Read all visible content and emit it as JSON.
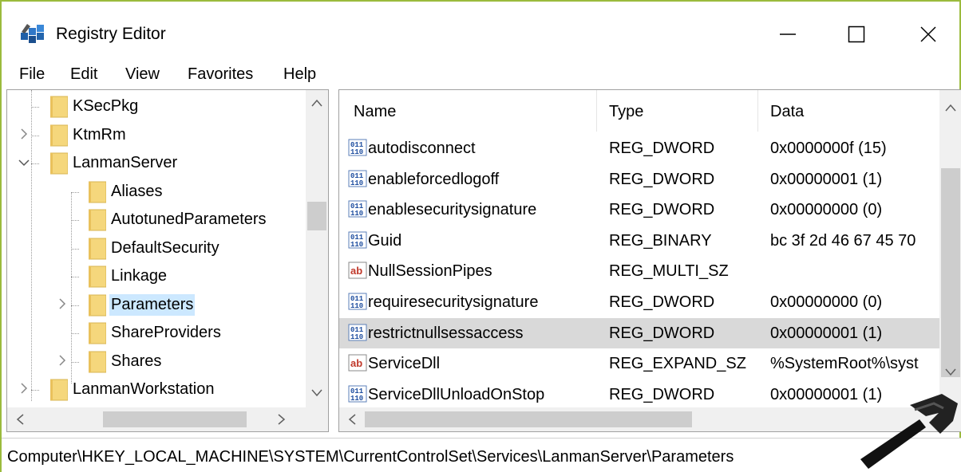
{
  "window": {
    "title": "Registry Editor"
  },
  "menu": [
    "File",
    "Edit",
    "View",
    "Favorites",
    "Help"
  ],
  "tree": [
    {
      "label": "KSecPkg",
      "level": 1,
      "expander": ""
    },
    {
      "label": "KtmRm",
      "level": 1,
      "expander": ">"
    },
    {
      "label": "LanmanServer",
      "level": 1,
      "expander": "v"
    },
    {
      "label": "Aliases",
      "level": 2,
      "expander": ""
    },
    {
      "label": "AutotunedParameters",
      "level": 2,
      "expander": ""
    },
    {
      "label": "DefaultSecurity",
      "level": 2,
      "expander": ""
    },
    {
      "label": "Linkage",
      "level": 2,
      "expander": ""
    },
    {
      "label": "Parameters",
      "level": 2,
      "expander": ">",
      "selected": true
    },
    {
      "label": "ShareProviders",
      "level": 2,
      "expander": ""
    },
    {
      "label": "Shares",
      "level": 2,
      "expander": ">"
    },
    {
      "label": "LanmanWorkstation",
      "level": 1,
      "expander": ">"
    }
  ],
  "columns": {
    "name": "Name",
    "type": "Type",
    "data": "Data"
  },
  "values": [
    {
      "name": "autodisconnect",
      "type": "REG_DWORD",
      "data": "0x0000000f (15)",
      "icon": "binary-value-icon"
    },
    {
      "name": "enableforcedlogoff",
      "type": "REG_DWORD",
      "data": "0x00000001 (1)",
      "icon": "binary-value-icon"
    },
    {
      "name": "enablesecuritysignature",
      "type": "REG_DWORD",
      "data": "0x00000000 (0)",
      "icon": "binary-value-icon"
    },
    {
      "name": "Guid",
      "type": "REG_BINARY",
      "data": "bc 3f 2d 46 67 45 70",
      "icon": "binary-value-icon"
    },
    {
      "name": "NullSessionPipes",
      "type": "REG_MULTI_SZ",
      "data": "",
      "icon": "string-value-icon"
    },
    {
      "name": "requiresecuritysignature",
      "type": "REG_DWORD",
      "data": "0x00000000 (0)",
      "icon": "binary-value-icon"
    },
    {
      "name": "restrictnullsessaccess",
      "type": "REG_DWORD",
      "data": "0x00000001 (1)",
      "icon": "binary-value-icon",
      "selected": true
    },
    {
      "name": "ServiceDll",
      "type": "REG_EXPAND_SZ",
      "data": "%SystemRoot%\\syst",
      "icon": "string-value-icon"
    },
    {
      "name": "ServiceDllUnloadOnStop",
      "type": "REG_DWORD",
      "data": "0x00000001 (1)",
      "icon": "binary-value-icon"
    }
  ],
  "status": {
    "path": "Computer\\HKEY_LOCAL_MACHINE\\SYSTEM\\CurrentControlSet\\Services\\LanmanServer\\Parameters"
  },
  "colors": {
    "accent_border": "#9bbb3d",
    "folder": "#f5d77c",
    "selected_tree": "#cce8ff",
    "selected_row": "#d9d9d9"
  }
}
